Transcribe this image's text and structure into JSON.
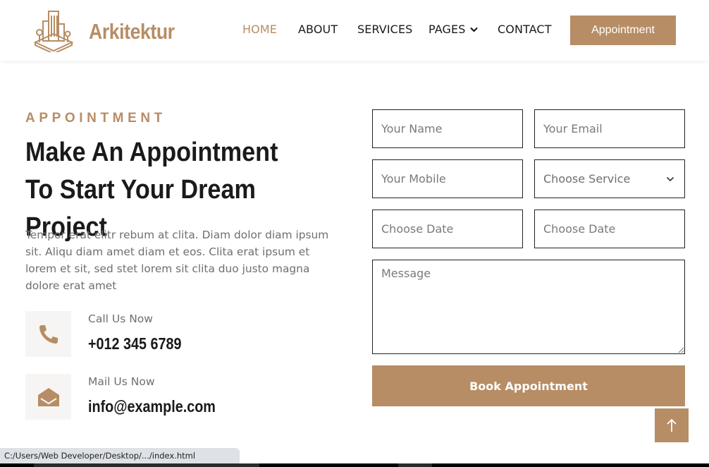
{
  "brand": {
    "name": "Arkitektur",
    "color": "#B78D65",
    "icon": "building-icon"
  },
  "nav": {
    "items": [
      {
        "label": "HOME",
        "active": true
      },
      {
        "label": "ABOUT",
        "active": false
      },
      {
        "label": "SERVICES",
        "active": false
      },
      {
        "label": "PAGES",
        "active": false,
        "dropdown": true
      },
      {
        "label": "CONTACT",
        "active": false
      }
    ],
    "appointment_button": "Appointment"
  },
  "appointment": {
    "label": "APPOINTMENT",
    "heading": "Make An Appointment To Start Your Dream Project",
    "paragraph": "Tempor erat elitr rebum at clita. Diam dolor diam ipsum sit. Aliqu diam amet diam et eos. Clita erat ipsum et lorem et sit, sed stet lorem sit clita duo justo magna dolore erat amet",
    "contacts": [
      {
        "icon": "phone-icon",
        "label": "Call Us Now",
        "value": "+012 345 6789"
      },
      {
        "icon": "envelope-open-icon",
        "label": "Mail Us Now",
        "value": "info@example.com"
      }
    ]
  },
  "form": {
    "name_placeholder": "Your Name",
    "email_placeholder": "Your Email",
    "mobile_placeholder": "Your Mobile",
    "service_selected": "Choose Service",
    "date1_placeholder": "Choose Date",
    "date2_placeholder": "Choose Date",
    "message_placeholder": "Message",
    "submit_label": "Book Appointment"
  },
  "back_to_top_icon": "arrow-up-icon",
  "statusbar": {
    "url": "C:/Users/Web Developer/Desktop/.../index.html"
  }
}
